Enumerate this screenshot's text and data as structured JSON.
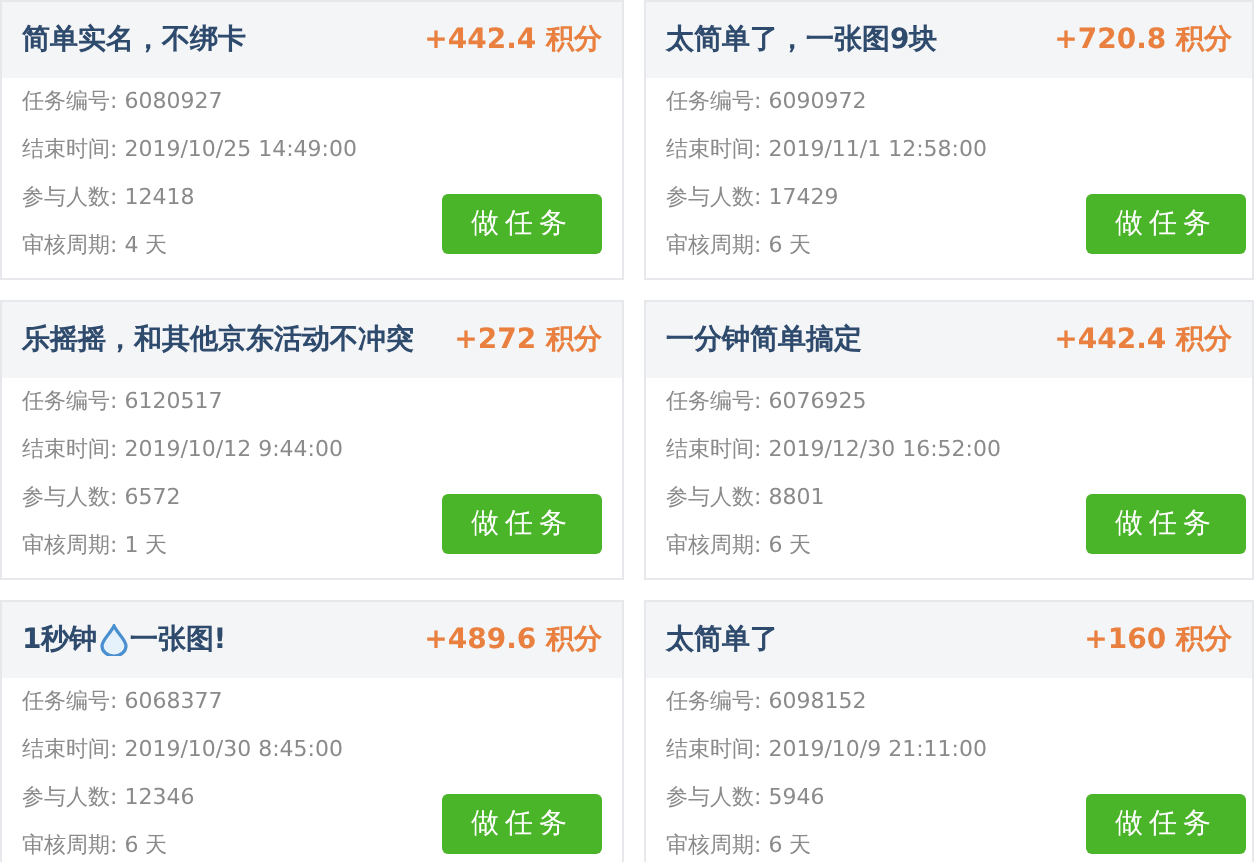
{
  "tasks": [
    {
      "title": "简单实名，不绑卡",
      "points": "+442.4",
      "unit": "积分",
      "fields": [
        {
          "label": "任务编号:",
          "value": "6080927"
        },
        {
          "label": "结束时间:",
          "value": "2019/10/25 14:49:00"
        },
        {
          "label": "参与人数:",
          "value": "12418"
        },
        {
          "label": "审核周期:",
          "value": "4 天"
        }
      ],
      "button": "做任务"
    },
    {
      "title": "太简单了，一张图9块",
      "points": "+720.8",
      "unit": "积分",
      "fields": [
        {
          "label": "任务编号:",
          "value": "6090972"
        },
        {
          "label": "结束时间:",
          "value": "2019/11/1 12:58:00"
        },
        {
          "label": "参与人数:",
          "value": "17429"
        },
        {
          "label": "审核周期:",
          "value": "6 天"
        }
      ],
      "button": "做任务"
    },
    {
      "title": "乐摇摇，和其他京东活动不冲突",
      "points": "+272",
      "unit": "积分",
      "fields": [
        {
          "label": "任务编号:",
          "value": "6120517"
        },
        {
          "label": "结束时间:",
          "value": "2019/10/12 9:44:00"
        },
        {
          "label": "参与人数:",
          "value": "6572"
        },
        {
          "label": "审核周期:",
          "value": "1 天"
        }
      ],
      "button": "做任务"
    },
    {
      "title": "一分钟简单搞定",
      "points": "+442.4",
      "unit": "积分",
      "fields": [
        {
          "label": "任务编号:",
          "value": "6076925"
        },
        {
          "label": "结束时间:",
          "value": "2019/12/30 16:52:00"
        },
        {
          "label": "参与人数:",
          "value": "8801"
        },
        {
          "label": "审核周期:",
          "value": "6 天"
        }
      ],
      "button": "做任务"
    },
    {
      "title": "1秒钟",
      "kind": "icon_title",
      "title_after": "一张图!",
      "points": "+489.6",
      "unit": "积分",
      "fields": [
        {
          "label": "任务编号:",
          "value": "6068377"
        },
        {
          "label": "结束时间:",
          "value": "2019/10/30 8:45:00"
        },
        {
          "label": "参与人数:",
          "value": "12346"
        },
        {
          "label": "审核周期:",
          "value": "6 天"
        }
      ],
      "button": "做任务"
    },
    {
      "title": "太简单了",
      "points": "+160",
      "unit": "积分",
      "fields": [
        {
          "label": "任务编号:",
          "value": "6098152"
        },
        {
          "label": "结束时间:",
          "value": "2019/10/9 21:11:00"
        },
        {
          "label": "参与人数:",
          "value": "5946"
        },
        {
          "label": "审核周期:",
          "value": "6 天"
        }
      ],
      "button": "做任务"
    }
  ]
}
